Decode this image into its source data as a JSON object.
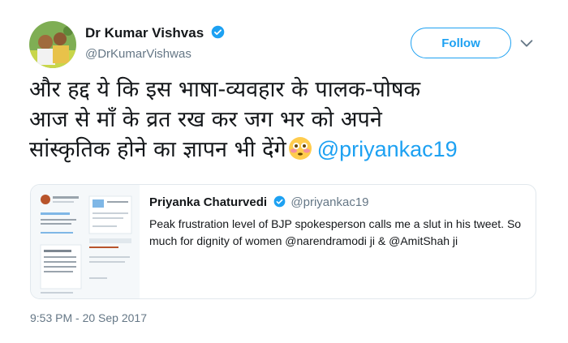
{
  "author": {
    "name": "Dr Kumar Vishvas",
    "handle": "@DrKumarVishwas",
    "avatar_icon": "profile-avatar"
  },
  "follow_label": "Follow",
  "tweet": {
    "lines": [
      "और हद्द ये कि इस भाषा-व्यवहार के पालक-पोषक",
      "आज से माँ के व्रत रख कर जग भर को अपने",
      "सांस्कृतिक होने का ज्ञापन भी देंगे"
    ],
    "emoji": "flushed-face-emoji",
    "mention": "@priyankac19"
  },
  "quoted": {
    "name": "Priyanka Chaturvedi",
    "handle": "@priyankac19",
    "text": "Peak frustration level of BJP spokesperson calls me a slut in his tweet. So much for dignity of women @narendramodi ji & @AmitShah ji"
  },
  "timestamp": "9:53 PM - 20 Sep 2017",
  "colors": {
    "accent": "#1da1f2",
    "text": "#14171a",
    "muted": "#657786"
  }
}
